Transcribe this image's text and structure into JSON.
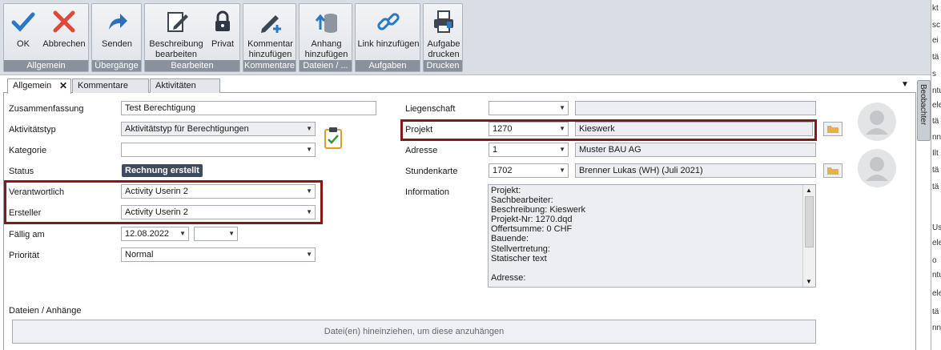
{
  "ribbon": {
    "groups": [
      {
        "label": "Allgemein",
        "buttons": [
          {
            "label": "OK",
            "icon": "checkmark-icon"
          },
          {
            "label": "Abbrechen",
            "icon": "close-icon"
          }
        ]
      },
      {
        "label": "Übergänge",
        "buttons": [
          {
            "label": "Senden",
            "icon": "send-arrow-icon"
          }
        ]
      },
      {
        "label": "Bearbeiten",
        "buttons": [
          {
            "label": "Beschreibung\nbearbeiten",
            "icon": "edit-document-icon"
          },
          {
            "label": "Privat",
            "icon": "lock-icon"
          }
        ]
      },
      {
        "label": "Kommentare",
        "buttons": [
          {
            "label": "Kommentar\nhinzufügen",
            "icon": "pen-add-icon"
          }
        ]
      },
      {
        "label": "Dateien / ...",
        "buttons": [
          {
            "label": "Anhang\nhinzufügen",
            "icon": "database-upload-icon"
          }
        ]
      },
      {
        "label": "Aufgaben",
        "buttons": [
          {
            "label": "Link hinzufügen",
            "icon": "chain-link-icon"
          }
        ]
      },
      {
        "label": "Drucken",
        "buttons": [
          {
            "label": "Aufgabe\ndrucken",
            "icon": "printer-icon"
          }
        ]
      }
    ]
  },
  "tabs": [
    {
      "label": "Allgemein",
      "active": true,
      "close": "✕"
    },
    {
      "label": "Kommentare",
      "active": false
    },
    {
      "label": "Aktivitäten",
      "active": false
    }
  ],
  "form_left": {
    "zusammenfassung": {
      "label": "Zusammenfassung",
      "value": "Test Berechtigung"
    },
    "aktivitaetstyp": {
      "label": "Aktivitätstyp",
      "value": "Aktivitätstyp für Berechtigungen"
    },
    "kategorie": {
      "label": "Kategorie",
      "value": ""
    },
    "status": {
      "label": "Status",
      "value": "Rechnung erstellt"
    },
    "verantwortlich": {
      "label": "Verantwortlich",
      "value": "Activity Userin 2"
    },
    "ersteller": {
      "label": "Ersteller",
      "value": "Activity Userin 2"
    },
    "faellig_am": {
      "label": "Fällig am",
      "date": "12.08.2022",
      "time": ""
    },
    "prioritaet": {
      "label": "Priorität",
      "value": "Normal"
    }
  },
  "form_right": {
    "liegenschaft": {
      "label": "Liegenschaft",
      "value": "",
      "description": ""
    },
    "projekt": {
      "label": "Projekt",
      "value": "1270",
      "description": "Kieswerk"
    },
    "adresse": {
      "label": "Adresse",
      "value": "1",
      "description": "Muster BAU AG"
    },
    "stundenkarte": {
      "label": "Stundenkarte",
      "value": "1702",
      "description": "Brenner Lukas (WH) (Juli 2021)"
    },
    "information": {
      "label": "Information",
      "text": "Projekt:\nSachbearbeiter:\nBeschreibung: Kieswerk\nProjekt-Nr: 1270.dqd\nOffertsumme: 0 CHF\nBauende:\nStellvertretung:\nStatischer text\n\nAdresse:"
    }
  },
  "attachments": {
    "label": "Dateien / Anhänge",
    "drop_hint": "Datei(en) hineinziehen, um diese anzuhängen"
  },
  "side_panel": {
    "label": "Beobachter"
  },
  "right_strip_fragments": [
    "kt",
    "sc",
    "ei",
    "tä",
    "s",
    "ntu",
    "ele",
    "tä",
    "nn",
    "Ilt",
    "tä",
    "tä",
    "Us",
    "ele",
    "o",
    "ntu",
    "ele",
    "tä",
    "nn"
  ],
  "colors": {
    "highlight": "#8b1616",
    "status_badge": "#3e4a5e",
    "ribbon_label": "#8a919c",
    "check_blue": "#2b79c6",
    "close_red": "#e2483a"
  }
}
